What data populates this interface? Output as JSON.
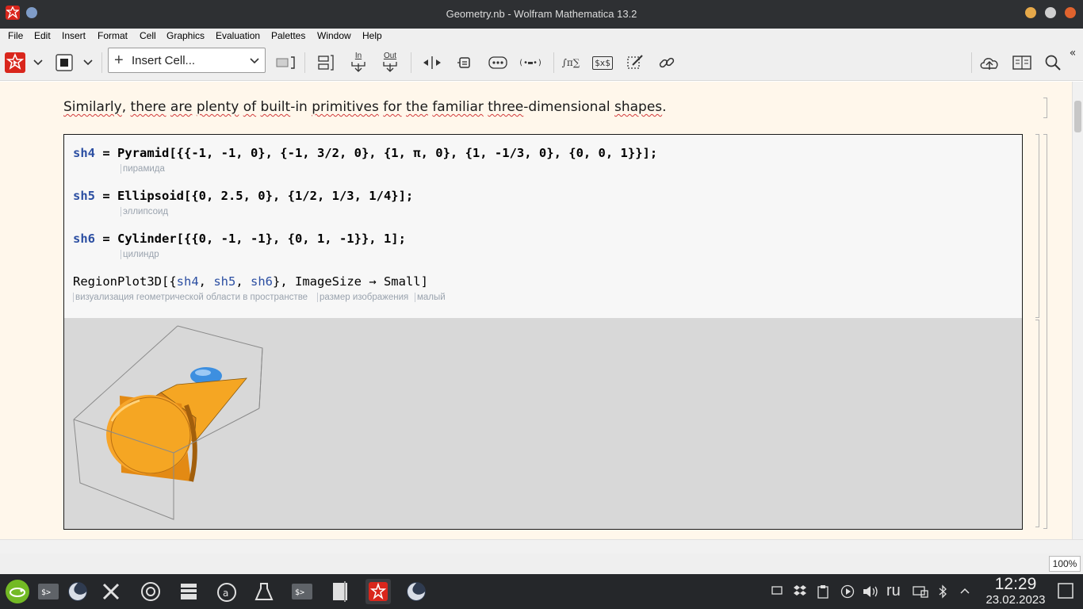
{
  "window": {
    "title": "Geometry.nb - Wolfram Mathematica 13.2"
  },
  "menu": [
    "File",
    "Edit",
    "Insert",
    "Format",
    "Cell",
    "Graphics",
    "Evaluation",
    "Palettes",
    "Window",
    "Help"
  ],
  "toolbar": {
    "insert_cell_label": "Insert Cell...",
    "in_label": "In",
    "out_label": "Out",
    "cell_group_label": "(•▬•)",
    "sum_label": "∫π∑",
    "tex_label": "$x$"
  },
  "notebook": {
    "text_parts": [
      {
        "t": "Similarly",
        "sq": true
      },
      {
        "t": ", ",
        "sq": false
      },
      {
        "t": "there",
        "sq": true
      },
      {
        "t": " ",
        "sq": false
      },
      {
        "t": "are",
        "sq": true
      },
      {
        "t": " ",
        "sq": false
      },
      {
        "t": "plenty",
        "sq": true
      },
      {
        "t": " ",
        "sq": false
      },
      {
        "t": "of",
        "sq": true
      },
      {
        "t": " ",
        "sq": false
      },
      {
        "t": "built",
        "sq": true
      },
      {
        "t": "-in ",
        "sq": false
      },
      {
        "t": "primitives",
        "sq": true
      },
      {
        "t": " ",
        "sq": false
      },
      {
        "t": "for",
        "sq": true
      },
      {
        "t": " ",
        "sq": false
      },
      {
        "t": "the",
        "sq": true
      },
      {
        "t": " ",
        "sq": false
      },
      {
        "t": "familiar",
        "sq": true
      },
      {
        "t": " ",
        "sq": false
      },
      {
        "t": "three",
        "sq": true
      },
      {
        "t": "-dimensional ",
        "sq": false
      },
      {
        "t": "shapes",
        "sq": true
      },
      {
        "t": ".",
        "sq": false
      }
    ],
    "code": {
      "line1_var": "sh4",
      "line1_rest": " = Pyramid[{{-1, -1, 0}, {-1, 3/2, 0}, {1, π, 0}, {1, -1/3, 0}, {0, 0, 1}}];",
      "hint1": "пирамида",
      "line2_var": "sh5",
      "line2_rest": " = Ellipsoid[{0, 2.5, 0}, {1/2, 1/3, 1/4}];",
      "hint2": "эллипсоид",
      "line3_var": "sh6",
      "line3_rest": " = Cylinder[{{0, -1, -1}, {0, 1, -1}}, 1];",
      "hint3": "цилиндр",
      "line4_head": "RegionPlot3D[{",
      "line4_v1": "sh4",
      "line4_c1": ", ",
      "line4_v2": "sh5",
      "line4_c2": ", ",
      "line4_v3": "sh6",
      "line4_tail": "}, ImageSize → Small]",
      "hint4a": "визуализация геометрической области в пространстве",
      "hint4b": "размер изображения",
      "hint4c": "малый"
    }
  },
  "status": {
    "zoom": "100%"
  },
  "taskbar": {
    "lang": "ru",
    "time": "12:29",
    "date": "23.02.2023"
  },
  "colors": {
    "titlebar": "#2e3033",
    "notebook_bg": "#fff7eb",
    "variable": "#2c4fa2",
    "shape_orange": "#f5a623",
    "ellipsoid_blue": "#3d8fe0"
  }
}
